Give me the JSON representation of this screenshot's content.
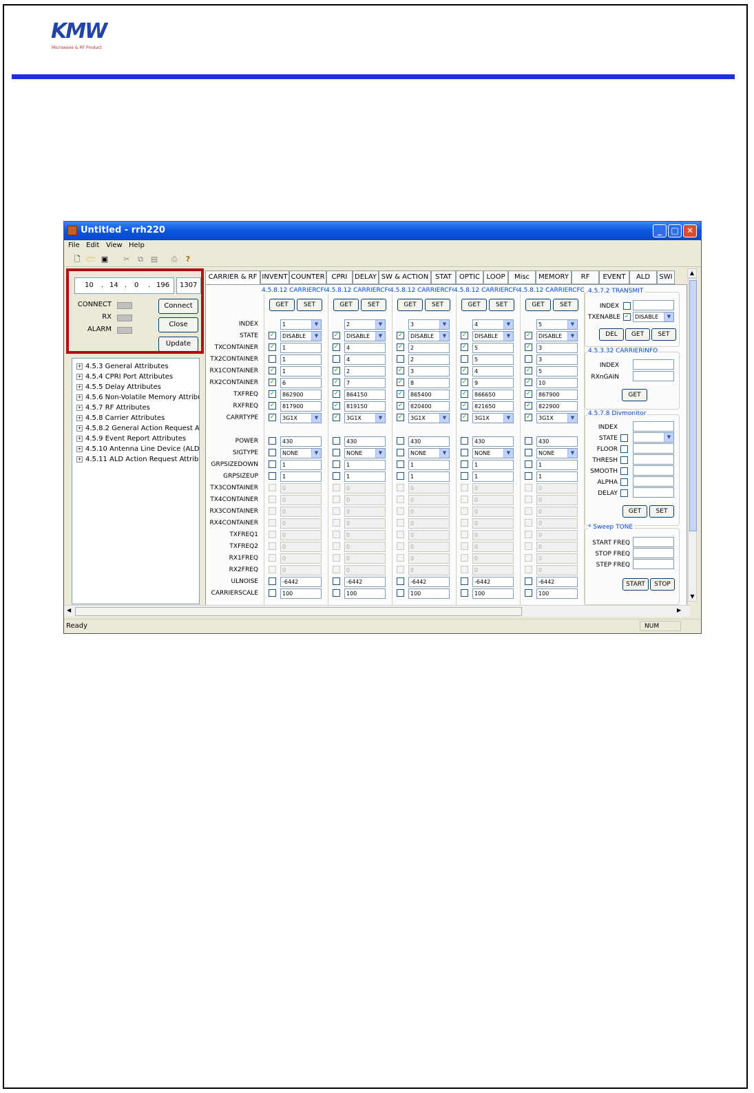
{
  "header": {
    "logo_text": "KMW",
    "logo_subtitle": "Microwave & RF Product"
  },
  "window": {
    "title": "Untitled - rrh220",
    "menu": [
      "File",
      "Edit",
      "View",
      "Help"
    ],
    "toolbar_icons": [
      "new-icon",
      "open-icon",
      "save-icon",
      "cut-icon",
      "copy-icon",
      "paste-icon",
      "print-icon",
      "help-icon"
    ]
  },
  "connection": {
    "ip": [
      "10",
      "14",
      "0",
      "196"
    ],
    "port": "1307",
    "status_labels": [
      "CONNECT",
      "RX",
      "ALARM"
    ],
    "buttons": {
      "connect": "Connect",
      "close": "Close",
      "update": "Update"
    }
  },
  "tree": [
    "4.5.3 General Attributes",
    "4.5.4 CPRI Port Attributes",
    "4.5.5 Delay Attributes",
    "4.5.6 Non-Volatile Memory Attribu",
    "4.5.7 RF Attributes",
    "4.5.8 Carrier Attributes",
    "4.5.8.2 General Action Request A",
    "4.5.9 Event Report Attributes",
    "4.5.10 Antenna Line Device (ALD)",
    "4.5.11 ALD Action Request Attribu"
  ],
  "tabs": [
    "CARRIER & RF",
    "INVENT",
    "COUNTER",
    "CPRI",
    "DELAY",
    "SW & ACTION",
    "STAT",
    "OPTIC",
    "LOOP",
    "Misc",
    "MEMORY",
    "RF",
    "EVENT",
    "ALD",
    "SWI"
  ],
  "carrier": {
    "group_title": "4.5.8.12 CARRIERCFG",
    "get_label": "GET",
    "set_label": "SET",
    "row_labels": [
      "INDEX",
      "STATE",
      "TXCONTAINER",
      "TX2CONTAINER",
      "RX1CONTAINER",
      "RX2CONTAINER",
      "TXFREQ",
      "RXFREQ",
      "CARRTYPE",
      "POWER",
      "SIGTYPE",
      "GRPSIZEDOWN",
      "GRPSIZEUP",
      "TX3CONTAINER",
      "TX4CONTAINER",
      "RX3CONTAINER",
      "RX4CONTAINER",
      "TXFREQ1",
      "TXFREQ2",
      "RX1FREQ",
      "RX2FREQ",
      "ULNOISE",
      "CARRIERSCALE"
    ],
    "columns": [
      {
        "index": "1",
        "state": "DISABLE",
        "txcontainer": "1",
        "tx2container": "1",
        "rx1container": "1",
        "rx2container": "6",
        "txfreq": "862900",
        "rxfreq": "817900",
        "carrtype": "3G1X",
        "power": "430",
        "sigtype": "NONE",
        "grpsizedown": "1",
        "grpsizeup": "1",
        "ulnoise": "-6442",
        "carrierscale": "100"
      },
      {
        "index": "2",
        "state": "DISABLE",
        "txcontainer": "4",
        "tx2container": "4",
        "rx1container": "2",
        "rx2container": "7",
        "txfreq": "864150",
        "rxfreq": "819150",
        "carrtype": "3G1X",
        "power": "430",
        "sigtype": "NONE",
        "grpsizedown": "1",
        "grpsizeup": "1",
        "ulnoise": "-6442",
        "carrierscale": "100"
      },
      {
        "index": "3",
        "state": "DISABLE",
        "txcontainer": "2",
        "tx2container": "2",
        "rx1container": "3",
        "rx2container": "8",
        "txfreq": "865400",
        "rxfreq": "820400",
        "carrtype": "3G1X",
        "power": "430",
        "sigtype": "NONE",
        "grpsizedown": "1",
        "grpsizeup": "1",
        "ulnoise": "-6442",
        "carrierscale": "100"
      },
      {
        "index": "4",
        "state": "DISABLE",
        "txcontainer": "5",
        "tx2container": "5",
        "rx1container": "4",
        "rx2container": "9",
        "txfreq": "866650",
        "rxfreq": "821650",
        "carrtype": "3G1X",
        "power": "430",
        "sigtype": "NONE",
        "grpsizedown": "1",
        "grpsizeup": "1",
        "ulnoise": "-6442",
        "carrierscale": "100"
      },
      {
        "index": "5",
        "state": "DISABLE",
        "txcontainer": "3",
        "tx2container": "3",
        "rx1container": "5",
        "rx2container": "10",
        "txfreq": "867900",
        "rxfreq": "822900",
        "carrtype": "3G1X",
        "power": "430",
        "sigtype": "NONE",
        "grpsizedown": "1",
        "grpsizeup": "1",
        "ulnoise": "-6442",
        "carrierscale": "100"
      }
    ],
    "disabled_value": "0"
  },
  "transmit": {
    "title": "4.5.7.2 TRANSMIT",
    "index_label": "INDEX",
    "txenable_label": "TXENABLE",
    "txenable_value": "DISABLE",
    "buttons": [
      "DEL",
      "GET",
      "SET"
    ]
  },
  "carrierinfo": {
    "title": "4.5.3.32 CARRIERINFO",
    "labels": [
      "INDEX",
      "RXnGAIN"
    ],
    "button": "GET"
  },
  "divmonitor": {
    "title": "4.5.7.8 Divmonitor",
    "labels": [
      "INDEX",
      "STATE",
      "FLOOR",
      "THRESH",
      "SMOOTH",
      "ALPHA",
      "DELAY"
    ],
    "buttons": [
      "GET",
      "SET"
    ]
  },
  "sweep": {
    "title": "* Sweep TONE",
    "labels": [
      "START FREQ",
      "STOP FREQ",
      "STEP FREQ"
    ],
    "buttons": [
      "START",
      "STOP"
    ]
  },
  "statusbar": {
    "text": "Ready",
    "num": "NUM"
  }
}
